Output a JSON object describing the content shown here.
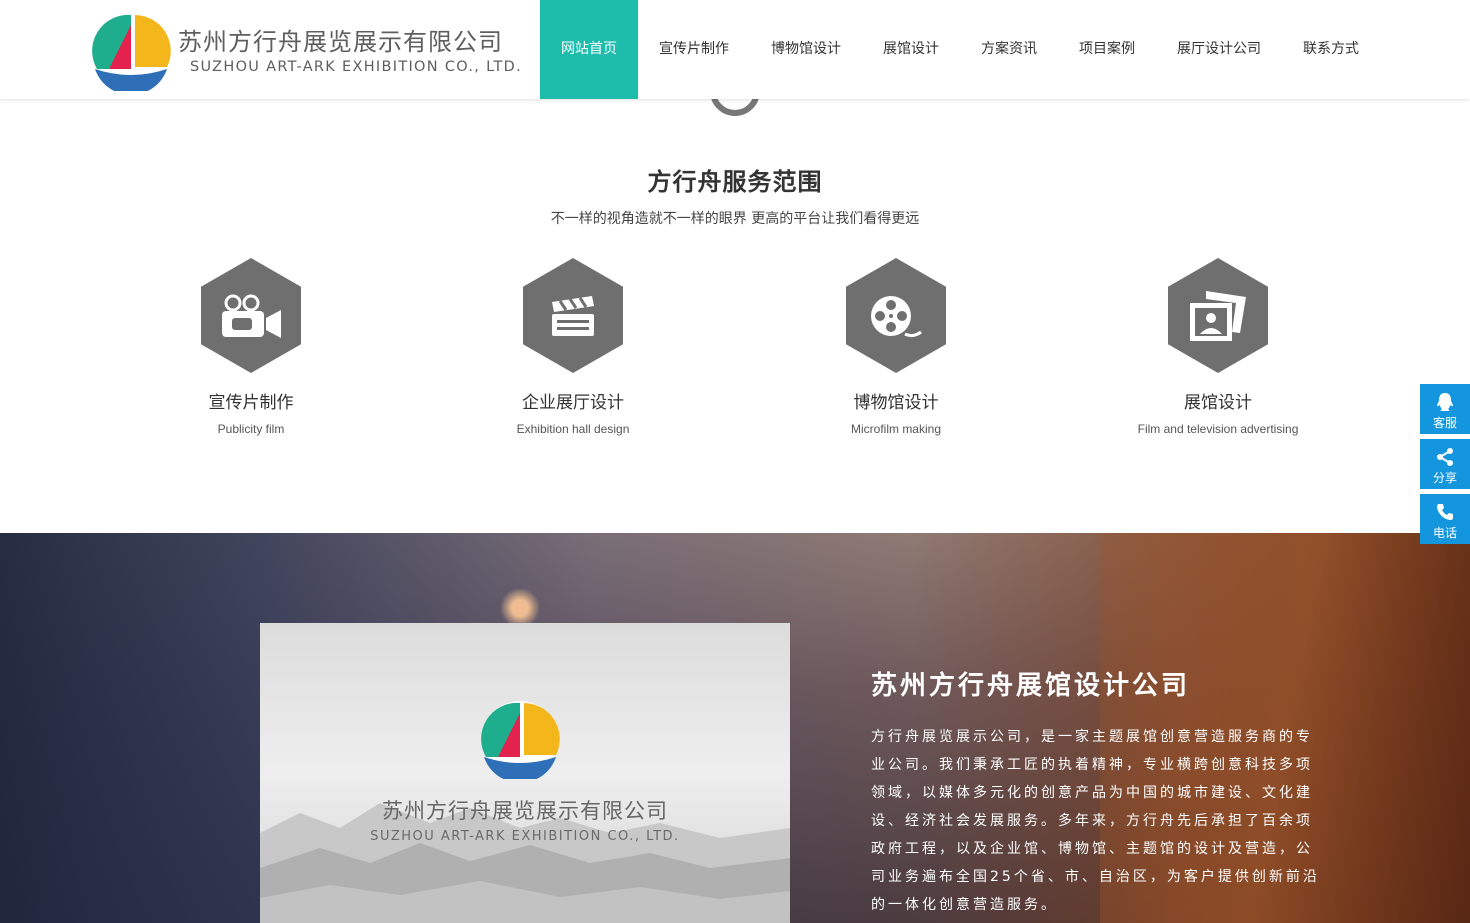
{
  "brand": {
    "name_cn": "苏州方行舟展览展示有限公司",
    "name_en": "SUZHOU ART-ARK EXHIBITION CO., LTD.",
    "colors": {
      "teal": "#1dbcab",
      "blue": "#1496df",
      "red": "#e3234d",
      "yellow": "#f3b71b",
      "green": "#1fae8d"
    }
  },
  "nav": {
    "items": [
      {
        "label": "网站首页",
        "active": true
      },
      {
        "label": "宣传片制作"
      },
      {
        "label": "博物馆设计"
      },
      {
        "label": "展馆设计"
      },
      {
        "label": "方案资讯"
      },
      {
        "label": "项目案例"
      },
      {
        "label": "展厅设计公司"
      },
      {
        "label": "联系方式"
      }
    ]
  },
  "services": {
    "title": "方行舟服务范围",
    "subtitle": "不一样的视角造就不一样的眼界 更高的平台让我们看得更远",
    "items": [
      {
        "icon": "video-camera-icon",
        "cn": "宣传片制作",
        "en": "Publicity film"
      },
      {
        "icon": "clapperboard-icon",
        "cn": "企业展厅设计",
        "en": "Exhibition hall design"
      },
      {
        "icon": "film-reel-icon",
        "cn": "博物馆设计",
        "en": "Microfilm making"
      },
      {
        "icon": "photo-icon",
        "cn": "展馆设计",
        "en": "Film and television advertising"
      }
    ]
  },
  "side": {
    "service": "客服",
    "share": "分享",
    "phone": "电话"
  },
  "about": {
    "title": "苏州方行舟展馆设计公司",
    "text": "方行舟展览展示公司，是一家主题展馆创意营造服务商的专业公司。我们秉承工匠的执着精神，专业横跨创意科技多项领域，以媒体多元化的创意产品为中国的城市建设、文化建设、经济社会发展服务。多年来，方行舟先后承担了百余项政府工程，以及企业馆、博物馆、主题馆的设计及营造，公司业务遍布全国25个省、市、自治区，为客户提供创新前沿的一体化创意营造服务。",
    "video_cn": "苏州方行舟展览展示有限公司",
    "video_en": "SUZHOU ART-ARK EXHIBITION CO., LTD."
  }
}
